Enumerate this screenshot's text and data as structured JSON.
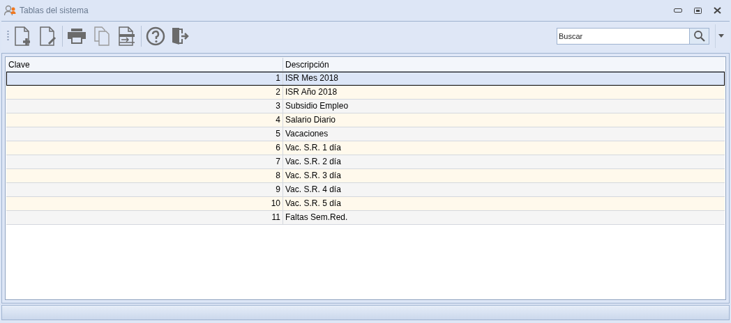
{
  "window": {
    "title": "Tablas del sistema"
  },
  "search": {
    "placeholder": "Buscar"
  },
  "table": {
    "columns": [
      "Clave",
      "Descripción"
    ],
    "rows": [
      {
        "clave": "1",
        "descripcion": "ISR Mes 2018",
        "selected": true
      },
      {
        "clave": "2",
        "descripcion": "ISR Año 2018",
        "selected": false
      },
      {
        "clave": "3",
        "descripcion": "Subsidio Empleo",
        "selected": false
      },
      {
        "clave": "4",
        "descripcion": "Salario Diario",
        "selected": false
      },
      {
        "clave": "5",
        "descripcion": "Vacaciones",
        "selected": false
      },
      {
        "clave": "6",
        "descripcion": "Vac. S.R. 1 día",
        "selected": false
      },
      {
        "clave": "7",
        "descripcion": "Vac. S.R. 2 día",
        "selected": false
      },
      {
        "clave": "8",
        "descripcion": "Vac. S.R. 3 día",
        "selected": false
      },
      {
        "clave": "9",
        "descripcion": "Vac. S.R. 4 día",
        "selected": false
      },
      {
        "clave": "10",
        "descripcion": "Vac. S.R. 5 día",
        "selected": false
      },
      {
        "clave": "11",
        "descripcion": "Faltas Sem.Red.",
        "selected": false
      }
    ]
  }
}
